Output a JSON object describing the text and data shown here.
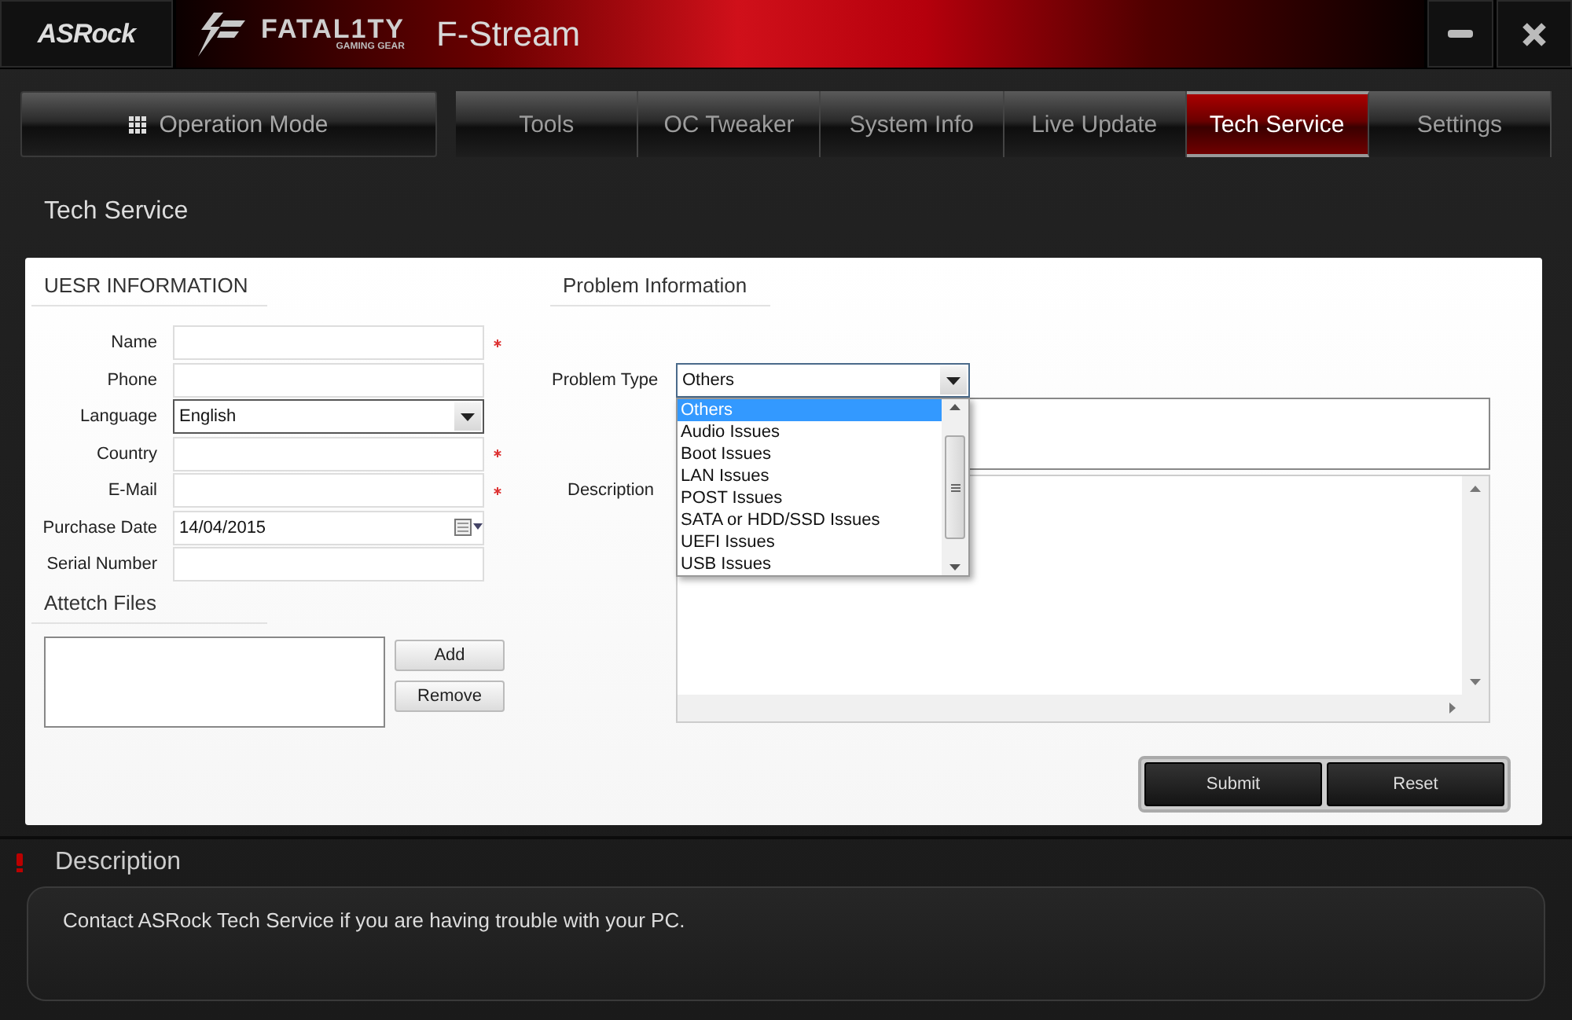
{
  "header": {
    "logo": "ASRock",
    "brand": "FATAL1TY",
    "brand_sub": "GAMING GEAR",
    "app_title": "F-Stream"
  },
  "nav": {
    "mode_button": "Operation Mode",
    "tabs": [
      {
        "label": "Tools",
        "selected": false
      },
      {
        "label": "OC Tweaker",
        "selected": false
      },
      {
        "label": "System Info",
        "selected": false
      },
      {
        "label": "Live Update",
        "selected": false
      },
      {
        "label": "Tech Service",
        "selected": true
      },
      {
        "label": "Settings",
        "selected": false
      }
    ]
  },
  "page_title": "Tech Service",
  "user_info": {
    "heading": "UESR INFORMATION",
    "fields": [
      {
        "label": "Name",
        "kind": "text",
        "required": true
      },
      {
        "label": "Phone",
        "kind": "text",
        "required": false
      },
      {
        "label": "Language",
        "kind": "select",
        "value": "English",
        "required": false
      },
      {
        "label": "Country",
        "kind": "text",
        "required": true
      },
      {
        "label": "E-Mail",
        "kind": "text",
        "required": true
      },
      {
        "label": "Purchase Date",
        "kind": "date",
        "value": "14/04/2015",
        "required": false
      },
      {
        "label": "Serial Number",
        "kind": "text",
        "required": false
      }
    ]
  },
  "attach": {
    "heading": "Attetch Files",
    "buttons": [
      "Add",
      "Remove"
    ]
  },
  "problem": {
    "heading": "Problem Information",
    "type_label": "Problem Type",
    "type_value": "Others",
    "options": [
      {
        "label": "Others",
        "selected": true
      },
      {
        "label": "Audio Issues",
        "selected": false
      },
      {
        "label": "Boot Issues",
        "selected": false
      },
      {
        "label": "LAN Issues",
        "selected": false
      },
      {
        "label": "POST Issues",
        "selected": false
      },
      {
        "label": "SATA or HDD/SSD Issues",
        "selected": false
      },
      {
        "label": "UEFI Issues",
        "selected": false
      },
      {
        "label": "USB Issues",
        "selected": false
      }
    ],
    "description_label": "Description"
  },
  "actions": [
    "Submit",
    "Reset"
  ],
  "description_panel": {
    "heading": "Description",
    "text": "Contact ASRock Tech Service if you are having trouble with your PC."
  }
}
